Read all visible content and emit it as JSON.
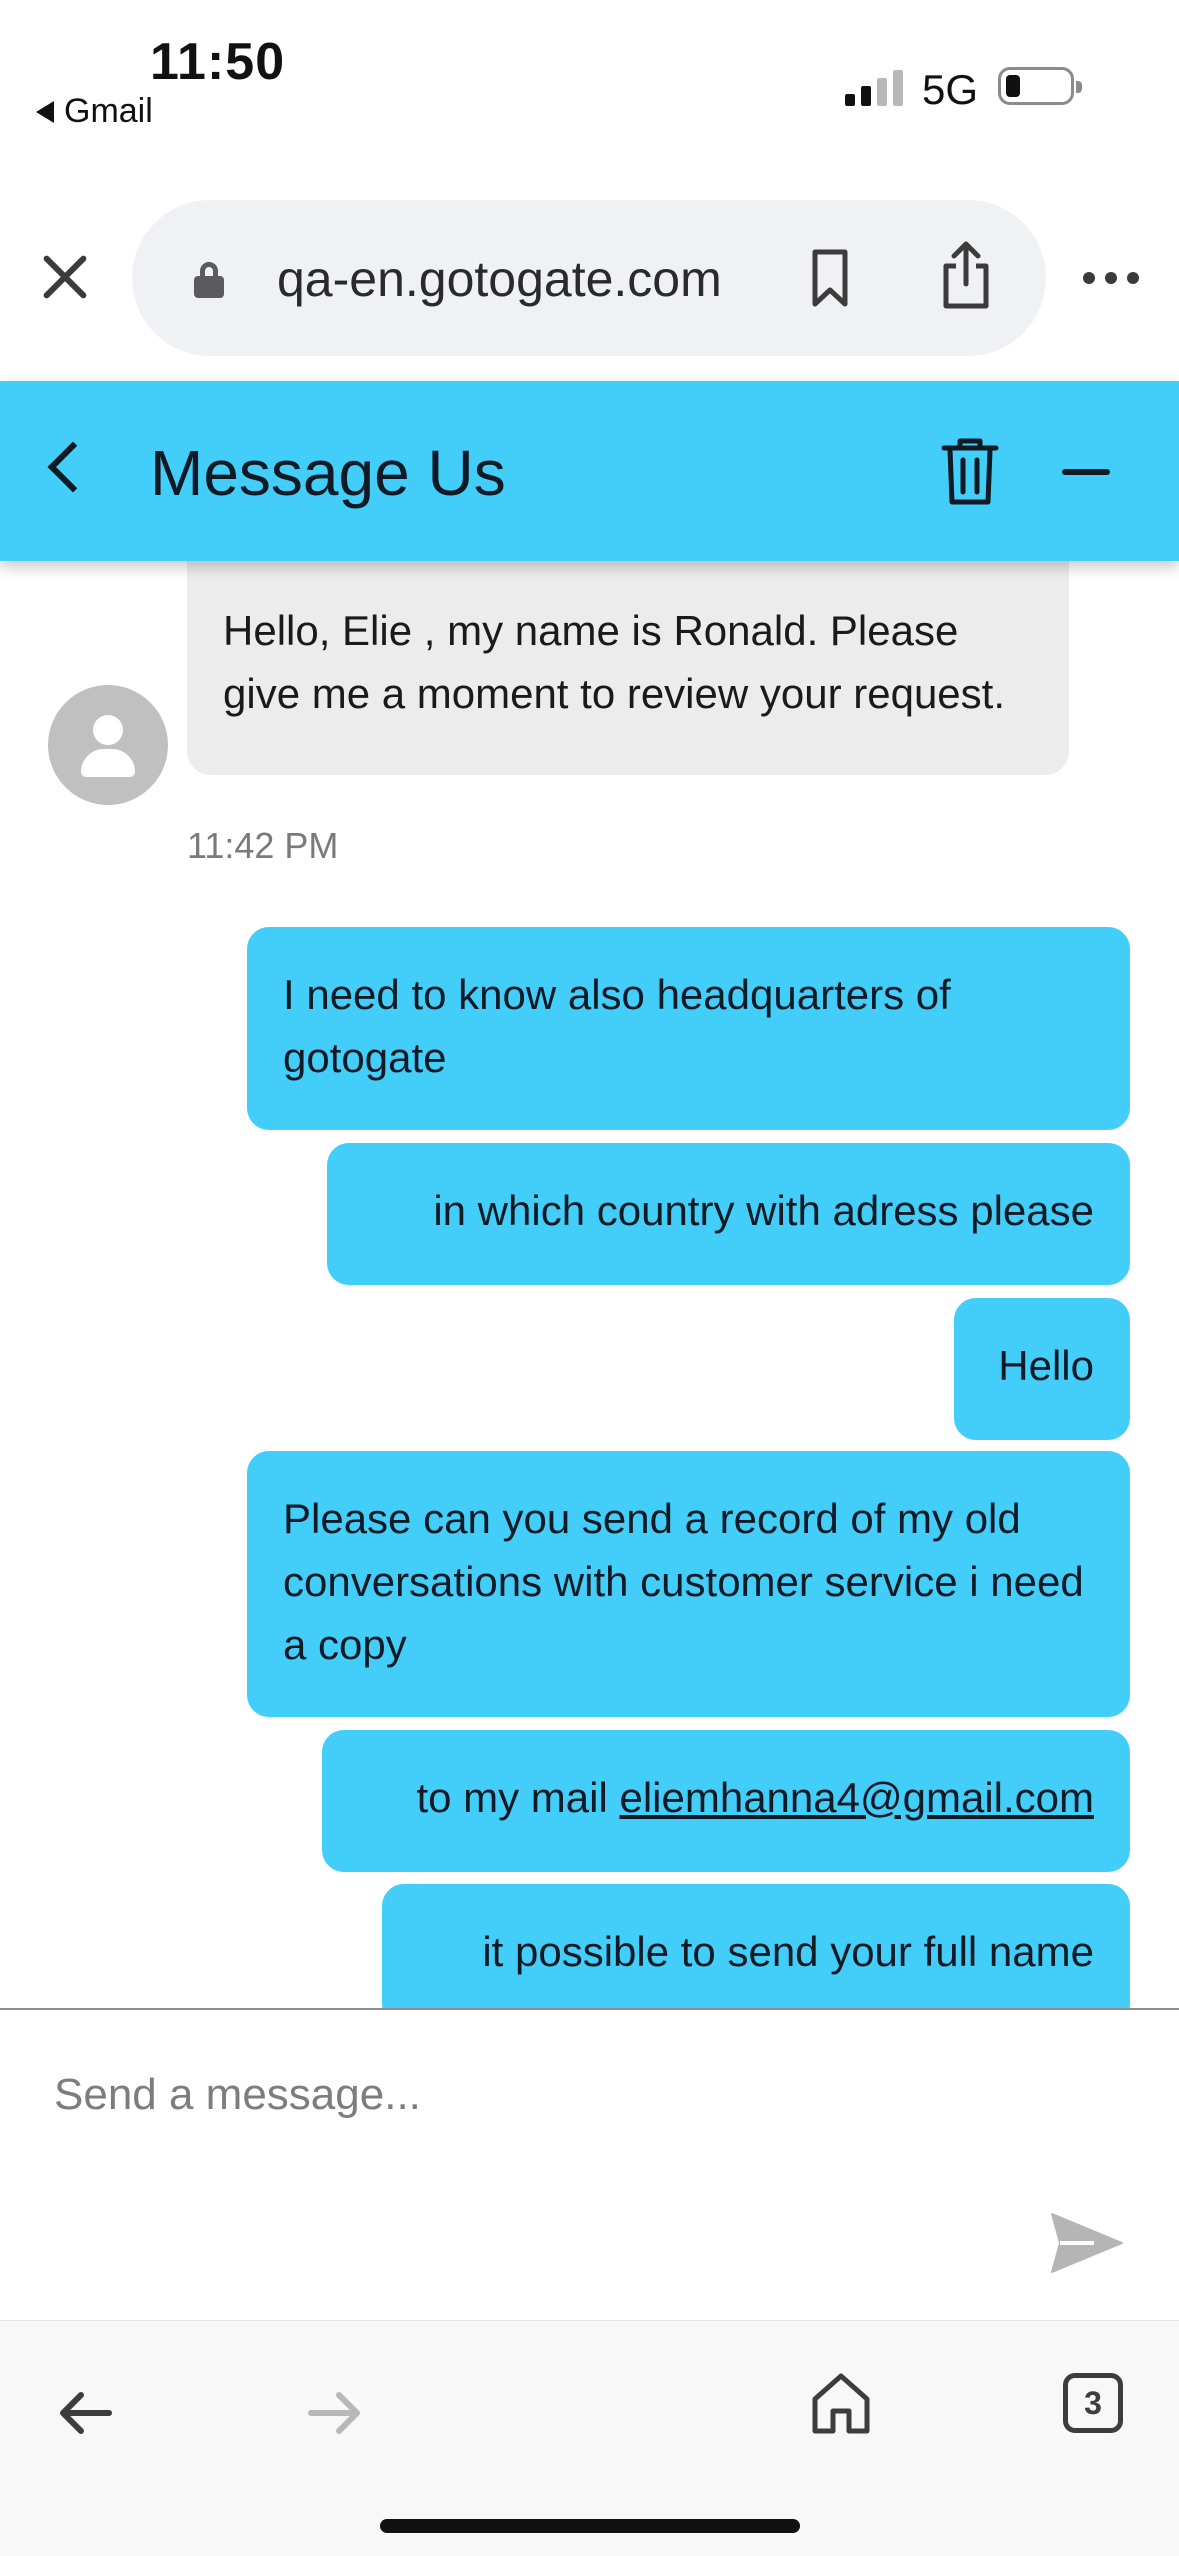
{
  "status_bar": {
    "time": "11:50",
    "back_app": "Gmail",
    "network": "5G"
  },
  "browser": {
    "url": "qa-en.gotogate.com",
    "tabs_count": "3"
  },
  "chat": {
    "title": "Message Us",
    "agent_message": {
      "text": "Hello, Elie , my name is Ronald. Please give me a moment to review your request.",
      "time": "11:42 PM"
    },
    "user_messages": [
      "I need to know also headquarters of gotogate",
      "in which country with adress please",
      "Hello",
      "Please can you send a record of my old conversations with customer service i need a copy",
      "it possible to send your full name"
    ],
    "mail_message": {
      "prefix": "to my mail ",
      "email": "eliemhanna4@gmail.com"
    },
    "composer_placeholder": "Send a message..."
  },
  "colors": {
    "accent": "#43cdf9",
    "agent_bubble": "#ececec"
  }
}
